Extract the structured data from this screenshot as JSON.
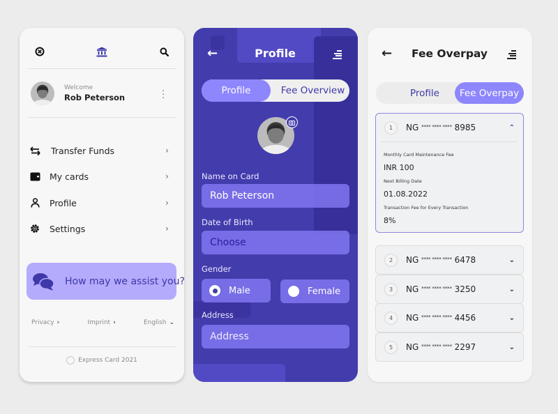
{
  "menu_panel": {
    "close_icon": "close-circle-icon",
    "logo_icon": "bank-icon",
    "search_icon": "search-icon",
    "welcome_label": "Welcome",
    "user_name": "Rob Peterson",
    "menu_items": [
      {
        "label": "Transfer Funds",
        "icon": "transfer-arrows-icon"
      },
      {
        "label": "My cards",
        "icon": "wallet-icon"
      },
      {
        "label": "Profile",
        "icon": "person-icon"
      },
      {
        "label": "Settings",
        "icon": "gear-icon"
      }
    ],
    "chevron": "›",
    "assist_label": "How may we assist you?",
    "footer_links": [
      {
        "label": "Privacy",
        "glyph": "›"
      },
      {
        "label": "Imprint",
        "glyph": "›"
      },
      {
        "label": "English",
        "glyph": "⌄"
      }
    ],
    "copyright": "Express Card 2021"
  },
  "profile_panel": {
    "back_glyph": "←",
    "title": "Profile",
    "tabs": {
      "active": "Profile",
      "inactive": "Fee Overview"
    },
    "fields": {
      "name_label": "Name on Card",
      "name_value": "Rob Peterson",
      "dob_label": "Date of Birth",
      "dob_value": "Choose",
      "gender_label": "Gender",
      "gender_options": [
        "Male",
        "Female"
      ],
      "gender_selected": "Male",
      "address_label": "Address",
      "address_placeholder": "Address"
    },
    "colors": {
      "background": "#433cac",
      "accent": "#8e86fc"
    }
  },
  "fee_panel": {
    "back_glyph": "←",
    "title": "Fee Overpay",
    "tabs": {
      "inactive": "Profile",
      "active": "Fee Overpay"
    },
    "cards": [
      {
        "index": "1",
        "prefix": "NG",
        "mask": "**** **** ****",
        "last4": "8985",
        "expanded": true,
        "details": [
          {
            "label": "Monthly Card Maintenance Fee",
            "value": "INR 100"
          },
          {
            "label": "Next Billing Date",
            "value": "01.08.2022"
          },
          {
            "label": "Transaction Fee for Every Transaction",
            "value": "8%"
          }
        ]
      },
      {
        "index": "2",
        "prefix": "NG",
        "mask": "**** **** ****",
        "last4": "6478",
        "expanded": false
      },
      {
        "index": "3",
        "prefix": "NG",
        "mask": "**** **** ****",
        "last4": "3250",
        "expanded": false
      },
      {
        "index": "4",
        "prefix": "NG",
        "mask": "**** **** ****",
        "last4": "4456",
        "expanded": false
      },
      {
        "index": "5",
        "prefix": "NG",
        "mask": "**** **** ****",
        "last4": "2297",
        "expanded": false
      }
    ],
    "chevron_up": "⌃",
    "chevron_down": "⌄"
  }
}
